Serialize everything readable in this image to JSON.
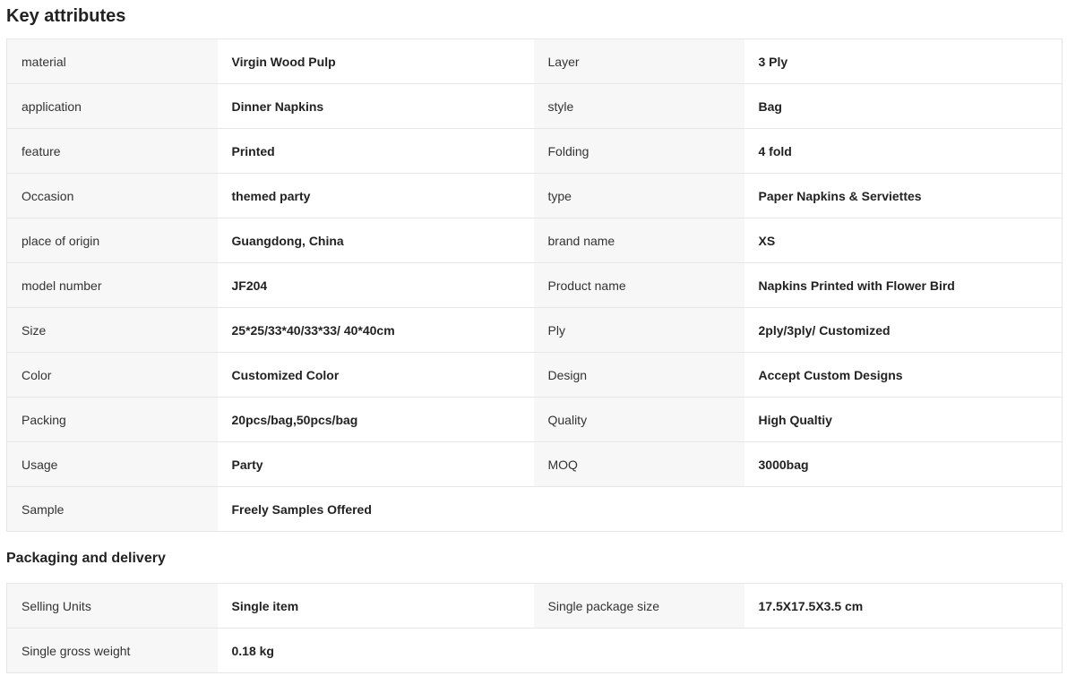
{
  "key_attributes": {
    "title": "Key attributes",
    "rows": [
      [
        {
          "k": "material",
          "v": "Virgin Wood Pulp"
        },
        {
          "k": "Layer",
          "v": "3 Ply"
        }
      ],
      [
        {
          "k": "application",
          "v": "Dinner Napkins"
        },
        {
          "k": "style",
          "v": "Bag"
        }
      ],
      [
        {
          "k": "feature",
          "v": "Printed"
        },
        {
          "k": "Folding",
          "v": "4 fold"
        }
      ],
      [
        {
          "k": "Occasion",
          "v": "themed party"
        },
        {
          "k": "type",
          "v": "Paper Napkins & Serviettes"
        }
      ],
      [
        {
          "k": "place of origin",
          "v": "Guangdong, China"
        },
        {
          "k": "brand name",
          "v": "XS"
        }
      ],
      [
        {
          "k": "model number",
          "v": "JF204"
        },
        {
          "k": "Product name",
          "v": "Napkins Printed with Flower Bird"
        }
      ],
      [
        {
          "k": "Size",
          "v": "25*25/33*40/33*33/ 40*40cm"
        },
        {
          "k": "Ply",
          "v": "2ply/3ply/ Customized"
        }
      ],
      [
        {
          "k": "Color",
          "v": "Customized Color"
        },
        {
          "k": "Design",
          "v": "Accept Custom Designs"
        }
      ],
      [
        {
          "k": "Packing",
          "v": "20pcs/bag,50pcs/bag"
        },
        {
          "k": "Quality",
          "v": "High Qualtiy"
        }
      ],
      [
        {
          "k": "Usage",
          "v": "Party"
        },
        {
          "k": "MOQ",
          "v": "3000bag"
        }
      ],
      [
        {
          "k": "Sample",
          "v": "Freely Samples Offered"
        }
      ]
    ]
  },
  "packaging": {
    "title": "Packaging and delivery",
    "rows": [
      [
        {
          "k": "Selling Units",
          "v": "Single item"
        },
        {
          "k": "Single package size",
          "v": "17.5X17.5X3.5 cm"
        }
      ],
      [
        {
          "k": "Single gross weight",
          "v": "0.18 kg"
        }
      ]
    ]
  }
}
